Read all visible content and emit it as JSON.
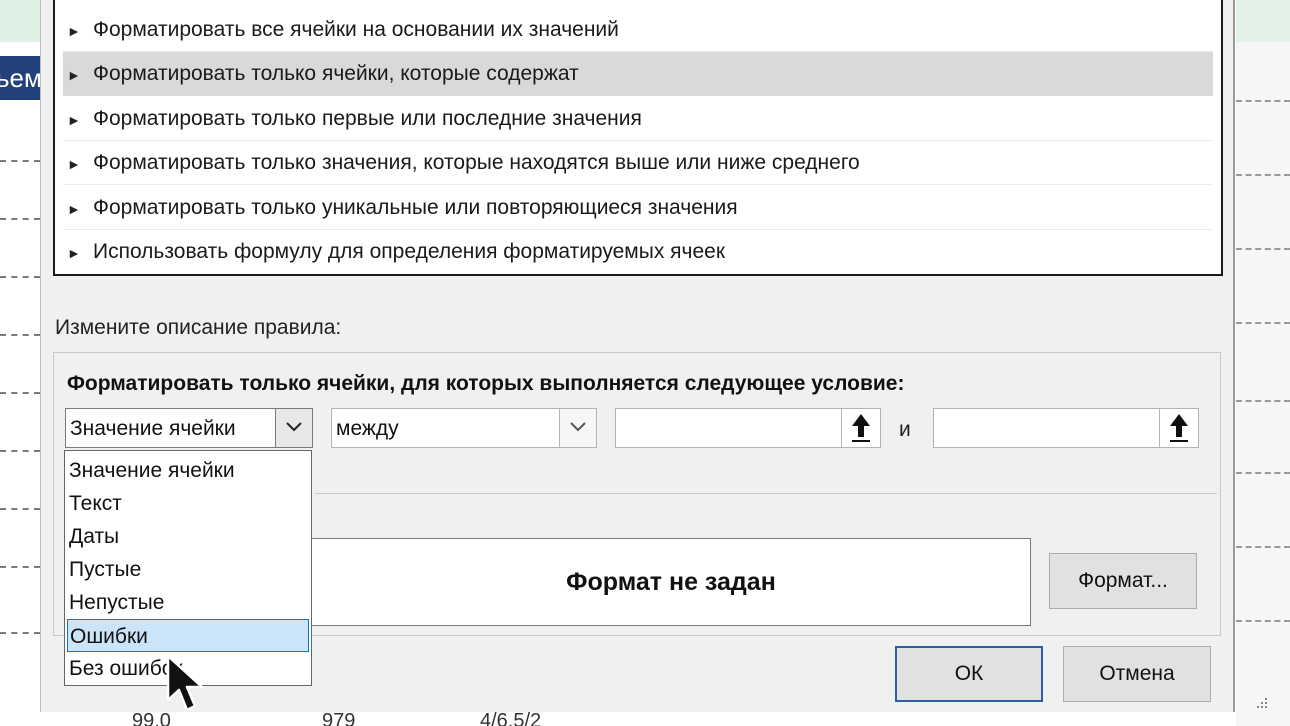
{
  "background": {
    "tab_text": "ьем",
    "bottom_fragments": [
      "99,0",
      "979",
      "4/6,5/2"
    ]
  },
  "rule_types": [
    "Форматировать все ячейки на основании их значений",
    "Форматировать только ячейки, которые содержат",
    "Форматировать только первые или последние значения",
    "Форматировать только значения, которые находятся выше или ниже среднего",
    "Форматировать только уникальные или повторяющиеся значения",
    "Использовать формулу для определения форматируемых ячеек"
  ],
  "selected_rule_index": 1,
  "edit_label": "Измените описание правила:",
  "condition_label": "Форматировать только ячейки, для которых выполняется следующее условие:",
  "condition": {
    "field_value": "Значение ячейки",
    "operator_value": "между",
    "value1": "",
    "value2": "",
    "and_label": "и"
  },
  "dropdown_options": [
    "Значение ячейки",
    "Текст",
    "Даты",
    "Пустые",
    "Непустые",
    "Ошибки",
    "Без ошибок"
  ],
  "highlighted_option_index": 5,
  "preview_text": "Формат не задан",
  "buttons": {
    "format": "Формат...",
    "ok": "ОК",
    "cancel": "Отмена"
  },
  "colors": {
    "dialog_bg": "#f0f0f0",
    "selected_rule": "#d9d9d9",
    "highlight": "#cce4f7",
    "highlight_border": "#0078d7",
    "ok_border": "#2a5fa8",
    "bg_tab": "#22407a"
  },
  "icons": {
    "rule_bullet": "right-triangle-icon",
    "dropdown": "chevron-down-icon",
    "ref_picker": "up-arrow-icon",
    "cursor": "mouse-pointer-icon"
  }
}
